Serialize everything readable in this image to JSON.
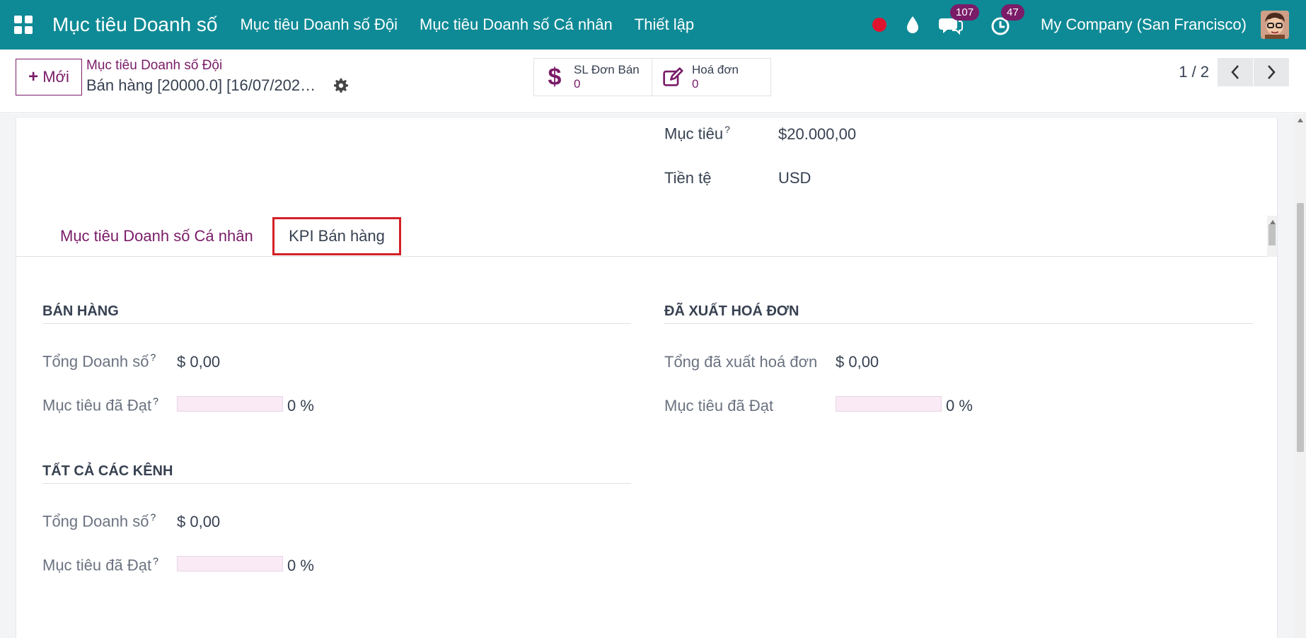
{
  "navbar": {
    "brand": "Mục tiêu Doanh số",
    "menu": [
      "Mục tiêu Doanh số Đội",
      "Mục tiêu Doanh số Cá nhân",
      "Thiết lập"
    ],
    "messages_count": "107",
    "activities_count": "47",
    "company": "My Company (San Francisco)",
    "colors": {
      "bar": "#0e8a96",
      "badge": "#7a1c68",
      "record": "#e0142f"
    }
  },
  "control": {
    "new_label": "Mới",
    "breadcrumb": "Mục tiêu Doanh số Đội",
    "record_title": "Bán hàng [20000.0] [16/07/202…",
    "smart_buttons": [
      {
        "label": "SL Đơn Bán",
        "value": "0",
        "icon": "dollar-icon"
      },
      {
        "label": "Hoá đơn",
        "value": "0",
        "icon": "edit-icon"
      }
    ],
    "pager": "1 / 2"
  },
  "form": {
    "target_label": "Mục tiêu",
    "target_value": "$20.000,00",
    "currency_label": "Tiền tệ",
    "currency_value": "USD",
    "help_mark": "?"
  },
  "tabs": [
    "Mục tiêu Doanh số Cá nhân",
    "KPI Bán hàng"
  ],
  "kpi": {
    "sales": {
      "title": "BÁN HÀNG",
      "total_label": "Tổng Doanh số",
      "total_value": "$ 0,00",
      "achieved_label": "Mục tiêu đã Đạt",
      "achieved_pct": 0,
      "achieved_text": "0 %"
    },
    "invoiced": {
      "title": "ĐÃ XUẤT HOÁ ĐƠN",
      "total_label": "Tổng đã xuất hoá đơn",
      "total_value": "$ 0,00",
      "achieved_label": "Mục tiêu đã Đạt",
      "achieved_pct": 0,
      "achieved_text": "0 %"
    },
    "all_channels": {
      "title": "TẤT CẢ CÁC KÊNH",
      "total_label": "Tổng Doanh số",
      "total_value": "$ 0,00",
      "achieved_label": "Mục tiêu đã Đạt",
      "achieved_pct": 0,
      "achieved_text": "0 %"
    }
  }
}
